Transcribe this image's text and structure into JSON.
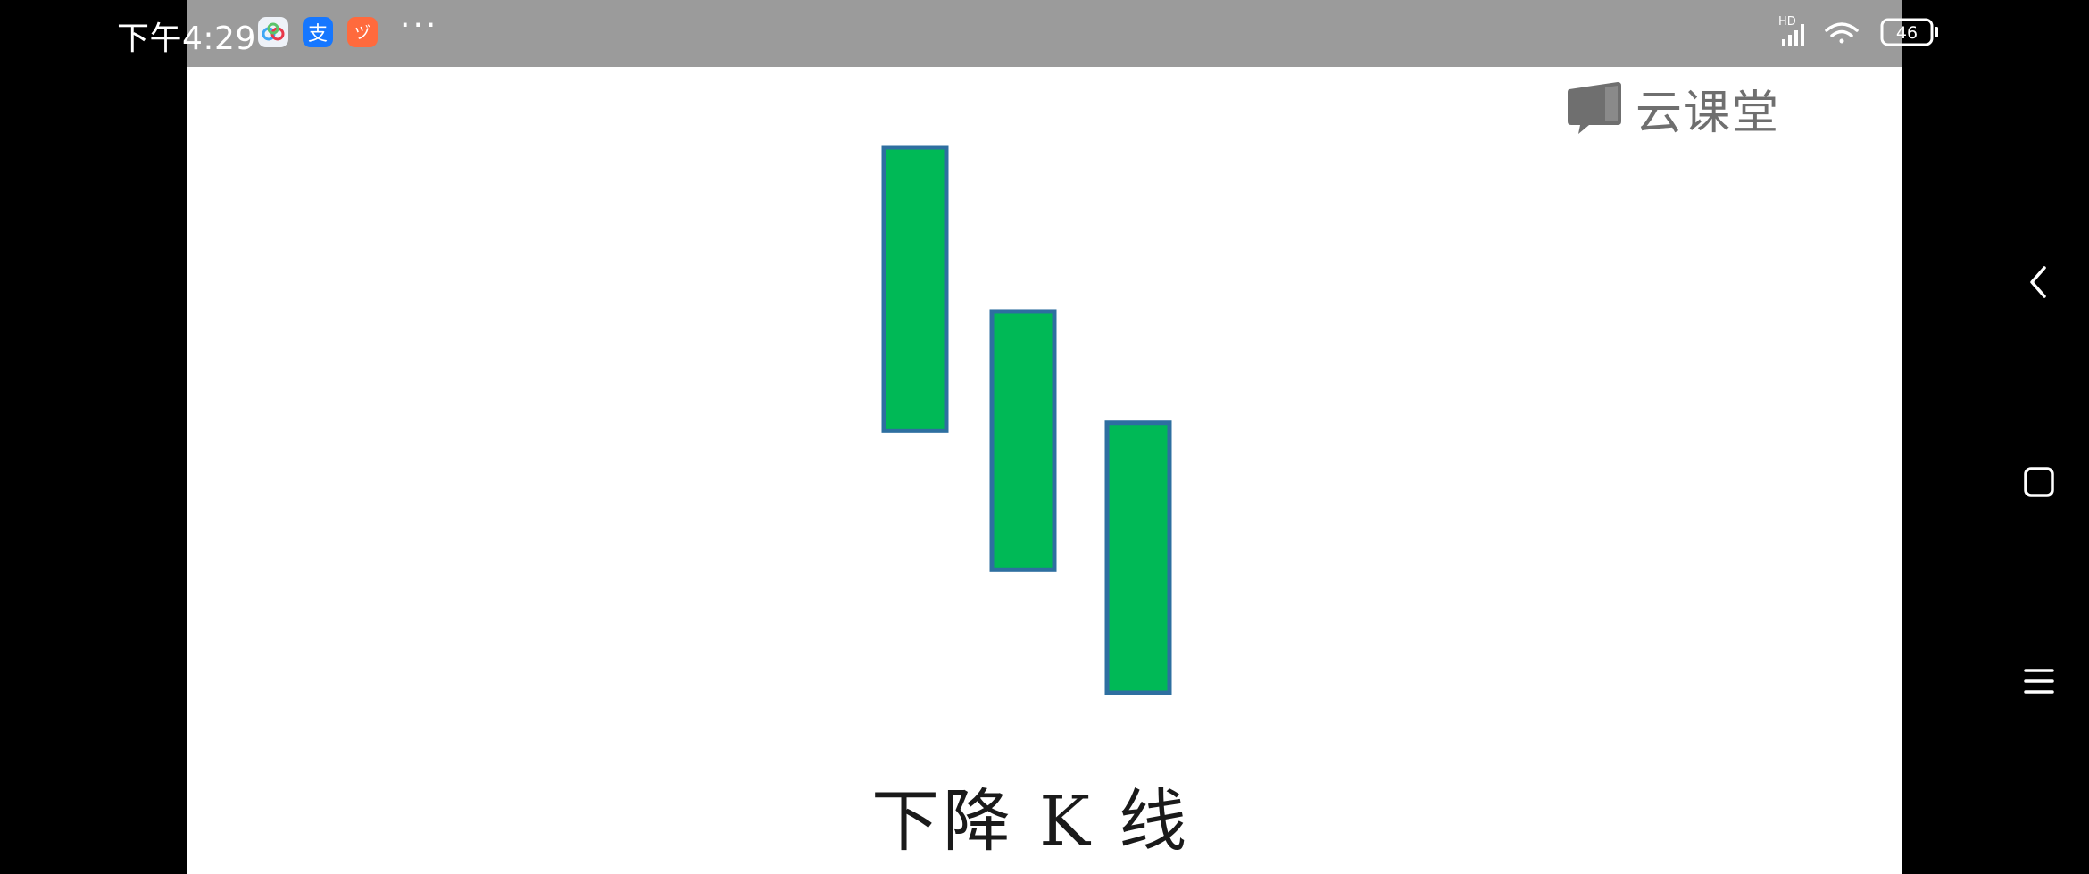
{
  "status_bar": {
    "time": "下午4:29",
    "apps": [
      {
        "name": "baidu-netdisk",
        "color": "#e9eef7"
      },
      {
        "name": "alipay",
        "glyph": "支",
        "color": "#1677ff"
      },
      {
        "name": "taobao",
        "glyph": "ヅ",
        "color": "#ff6a3d"
      }
    ],
    "more": "···",
    "network_label": "HD",
    "battery": "46"
  },
  "watermark": {
    "text": "云课堂"
  },
  "chart_data": {
    "type": "candlestick",
    "title": "下降 K 线",
    "candles": [
      {
        "open": 100,
        "close": 70.5
      },
      {
        "open": 82.9,
        "close": 56
      },
      {
        "open": 71.3,
        "close": 43.2
      }
    ],
    "fill_color": "#00b956",
    "edge_color": "#2e6fa0"
  },
  "nav": {
    "back": "back",
    "home": "home",
    "menu": "menu"
  }
}
